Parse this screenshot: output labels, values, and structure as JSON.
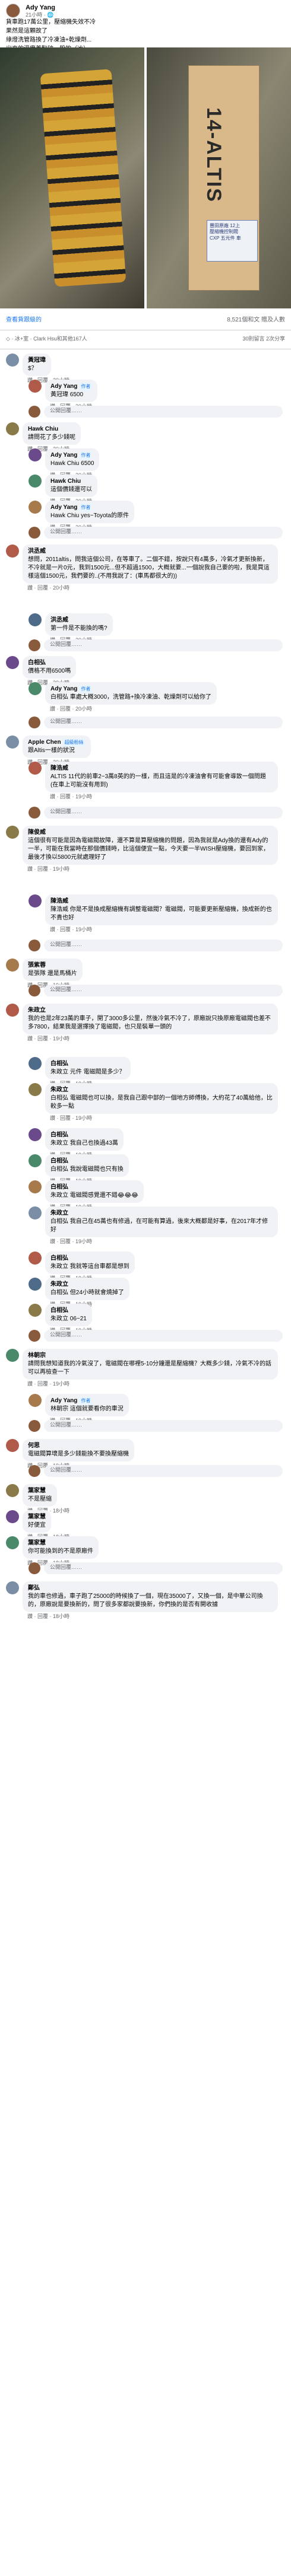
{
  "post": {
    "author": "Ady Yang",
    "time": "21小時 · ",
    "text_lines": [
      "貨車跑17萬公里，壓縮機失效不冷",
      "果然是這顆故了",
      "綠燈洗管路換了冷凍油+乾燥劑...",
      "出來的溫度差點破一般的（冰）"
    ],
    "watermark": "Siena-Club.tw"
  },
  "photo_right": {
    "box_text": "14-ALTIS",
    "sticker_lines": [
      "豐田原廠 12上",
      "壓縮機控制閥",
      "CXP 五元件 車"
    ]
  },
  "stats": {
    "left": "查看貨跟級的",
    "right": "8,521個和文 贈及人數"
  },
  "sort": {
    "left": "◇ · 冰+室 · Clark Hsu和其他167人",
    "right": "30則留言 2次分享"
  },
  "comments": [
    {
      "author": "黃冠瑋",
      "text": "$？",
      "actions": "讚 · 回覆 · 20小時"
    },
    {
      "author": "Ady Yang",
      "badge": "作者",
      "text": "黃冠瑋 6500",
      "actions": "讚 · 回覆 · 20小時"
    },
    {
      "reply_placeholder": "公開回覆……"
    },
    {
      "author": "Hawk Chiu",
      "text": "請問花了多少錢呢",
      "actions": "讚 · 回覆 · 20小時"
    },
    {
      "author": "Ady Yang",
      "badge": "作者",
      "text": "Hawk Chiu 6500",
      "actions": "讚 · 回覆 · 20小時"
    },
    {
      "author": "Hawk Chiu",
      "text": "這個價錢還可以",
      "actions": "讚 · 回覆 · 20小時"
    },
    {
      "author": "Ady Yang",
      "badge": "作者",
      "text": "Hawk Chiu yes~Toyota的原件",
      "actions": "讚 · 回覆 · 20小時"
    },
    {
      "reply_placeholder": "公開回覆……"
    },
    {
      "author": "洪丞威",
      "text": "想問，2011altis，問我這個公司，在等車了。二個不錯，按說只有4萬多，冷氣才更新換新，不冷就是一片0元，我到1500元...但不超過1500，大概就要...一個說我自己要的啦，我是買這樣這個1500元，我們要的..(不用我說了：(車馬都很大的))",
      "actions": "讚 · 回覆 · 20小時"
    },
    {
      "author": "洪丞威",
      "text": "第一件是不能換的嗎?",
      "actions": "讚 · 回覆 · 20小時"
    },
    {
      "reply_placeholder": "公開回覆……"
    },
    {
      "author": "白相弘",
      "text": "價格不用6500嗎",
      "actions": "讚 · 回覆 · 20小時"
    },
    {
      "author": "Ady Yang",
      "badge": "作者",
      "text": "白相弘 車處大概3000，洗管路+換冷凍油、乾燥劑可以給你了",
      "actions": "讚 · 回覆 · 20小時"
    },
    {
      "reply_placeholder": "公開回覆……"
    },
    {
      "author": "Apple Chen",
      "badge": "超級粉絲",
      "text": "跟Altis一樣的狀況",
      "actions": "讚 · 回覆 · 20小時"
    },
    {
      "author": "陳浩威",
      "text": "ALTIS 11代的前車2~3萬8英的的一樣，而且這是的冷凍油會有可能會導致一個問題(在車上可能沒有用到)",
      "actions": "讚 · 回覆 · 19小時"
    },
    {
      "reply_placeholder": "公開回覆……"
    },
    {
      "author": "陳俊威",
      "text": "這個很有可能是因為電磁閥故障，還不算是算壓縮機的問題，因為我就是Ady換的還有Ady的一半，可能在我當時在那個價錢時，比這個便宜一點，今天要一半WISH壓縮機，要回到家，最後才換以5800元就處理好了",
      "actions": "讚 · 回覆 · 19小時"
    },
    {
      "author": "陳浩威",
      "text": "陳浩威 你是不是換成壓縮機有調整電磁閥？電磁閥，可能要更新壓縮機，換成新的也不貴也好",
      "actions": "讚 · 回覆 · 19小時"
    },
    {
      "reply_placeholder": "公開回覆……"
    },
    {
      "author": "張紫蓉",
      "text": "是張隊 還是馬桶片",
      "actions": "讚 · 回覆 · 19小時"
    },
    {
      "reply_placeholder": "公開回覆……"
    },
    {
      "author": "朱政立",
      "text": "我的也是2年23萬的車子，開了3000多公里，然後冷氣不冷了，原廠說只換原廠電磁閥也差不多7800，結果我是選擇換了電磁閥，也只是裝單一頭的",
      "actions": "讚 · 回覆 · 19小時"
    },
    {
      "author": "白相弘",
      "text": "朱政立 元件 電磁閥是多少？",
      "actions": "讚 · 回覆 · 19小時"
    },
    {
      "author": "朱政立",
      "text": "白相弘 電磁閥也可以換，是我自己跟中部的一個地方師傅換，大約花了40萬給他，比較多一點",
      "actions": "讚 · 回覆 · 19小時"
    },
    {
      "author": "白相弘",
      "text": "朱政立 我自己也換過43萬",
      "actions": "讚 · 回覆 · 19小時"
    },
    {
      "author": "白相弘",
      "text": "白相弘 我說電磁閥也只有換",
      "actions": "讚 · 回覆 · 19小時"
    },
    {
      "author": "白相弘",
      "text": "朱政立 電磁閥感覺還不錯😂😂😂",
      "actions": "讚 · 回覆 · 19小時"
    },
    {
      "author": "朱政立",
      "text": "白相弘 我自己在45萬也有修過，在可能有算過，後來大概都是好事，在2017年才修好",
      "actions": "讚 · 回覆 · 19小時"
    },
    {
      "author": "白相弘",
      "text": "朱政立 我就等這台車都是想到",
      "actions": "讚 · 回覆 · 19小時"
    },
    {
      "author": "朱政立",
      "text": "白相弘 但24小時就會燒掉了",
      "actions": "讚 · 回覆 · 19小時"
    },
    {
      "author": "白相弘",
      "text": "朱政立 06~21",
      "actions": "讚 · 回覆 · 19小時"
    },
    {
      "reply_placeholder": "公開回覆……"
    },
    {
      "author": "林朝宗",
      "text": "請問我想知道我的冷氣沒了，電磁閥在哪裡5-10分鐘還是壓縮機？大概多少錢，冷氣不冷的話可以再檢查一下",
      "actions": "讚 · 回覆 · 19小時"
    },
    {
      "author": "Ady Yang",
      "badge": "作者",
      "text": "林朝宗 這個就要看你的車況",
      "actions": "讚 · 回覆 · 19小時"
    },
    {
      "reply_placeholder": "公開回覆……"
    },
    {
      "author": "何思",
      "text": "電磁閥算壞是多少錢能換不要換壓縮機",
      "actions": "讚 · 回覆 · 19小時"
    },
    {
      "reply_placeholder": "公開回覆……"
    },
    {
      "author": "葉家慧",
      "text": "不是壓縮",
      "actions": "讚 · 回覆 · 18小時"
    },
    {
      "author": "葉家慧",
      "text": "好便宜",
      "actions": "讚 · 回覆 · 18小時"
    },
    {
      "author": "葉家慧",
      "text": "你可能換到的不是原廠件",
      "actions": "讚 · 回覆 · 18小時"
    },
    {
      "reply_placeholder": "公開回覆……"
    },
    {
      "author": "鄭弘",
      "text": "我的車也修過，車子跑了25000的時候換了一個，現在35000了，又換一個，是中華公司換的，原廠說是要換新的，問了很多家都說要換新，你們換的是否有開收據",
      "actions": "讚 · 回覆 · 18小時"
    }
  ]
}
